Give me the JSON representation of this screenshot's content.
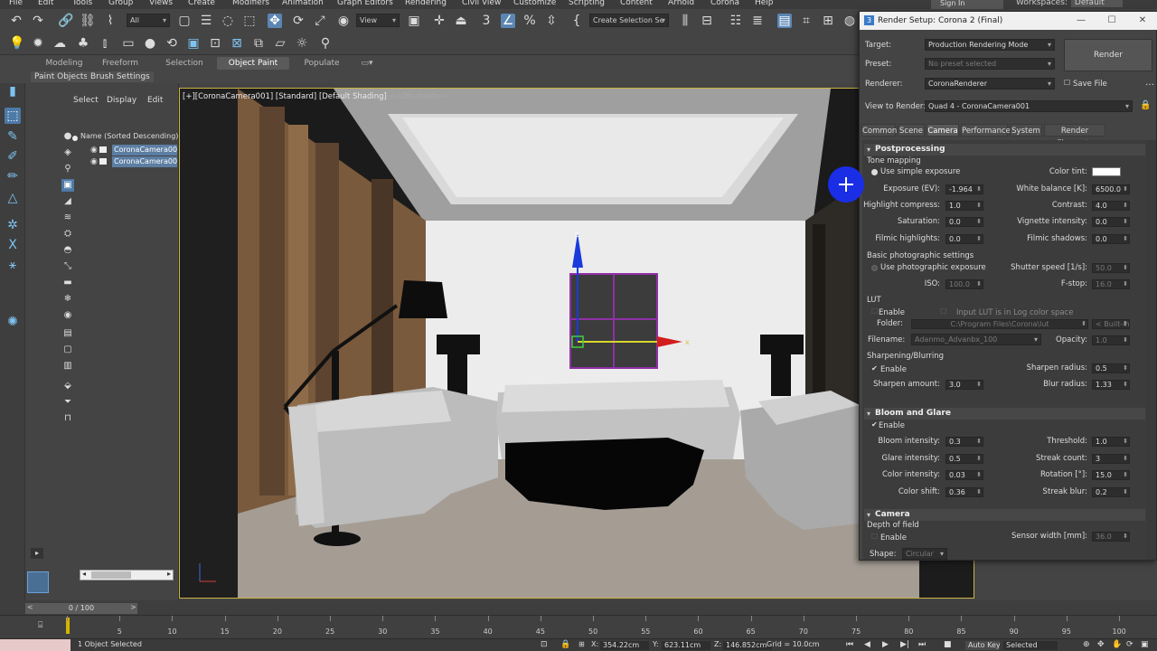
{
  "menubar": {
    "items": [
      "File",
      "Edit",
      "Tools",
      "Group",
      "Views",
      "Create",
      "Modifiers",
      "Animation",
      "Graph Editors",
      "Rendering",
      "Civil View",
      "Customize",
      "Scripting",
      "Content",
      "Arnold",
      "Corona",
      "Help"
    ],
    "sign_in": "Sign In",
    "workspaces_label": "Workspaces:",
    "workspaces_value": "Default"
  },
  "toolbar": {
    "filter": "All",
    "ref_coord": "View",
    "selection_set": "Create Selection Se"
  },
  "ribbon": {
    "tabs": [
      "Modeling",
      "Freeform",
      "Selection",
      "Object Paint",
      "Populate"
    ],
    "active_tab": "Object Paint",
    "subtabs": [
      "Paint Objects",
      "Brush Settings"
    ]
  },
  "explorer": {
    "tabs": [
      "Select",
      "Display",
      "Edit"
    ],
    "column_header": "Name (Sorted Descending)",
    "rows": [
      "CoronaCamera00",
      "CoronaCamera00"
    ]
  },
  "viewport": {
    "label_parts": [
      "[+]",
      "[CoronaCamera001]",
      "[Standard]",
      "[Default Shading]",
      "<<Disabled>>"
    ],
    "axis_labels": [
      "z",
      "x"
    ]
  },
  "render_setup": {
    "title": "Render Setup: Corona 2 (Final)",
    "target_label": "Target:",
    "target_value": "Production Rendering Mode",
    "preset_label": "Preset:",
    "preset_value": "No preset selected",
    "renderer_label": "Renderer:",
    "renderer_value": "CoronaRenderer",
    "save_file": "Save File",
    "view_label": "View to Render:",
    "view_value": "Quad 4 - CoronaCamera001",
    "render_button": "Render",
    "tabs": [
      "Common",
      "Scene",
      "Camera",
      "Performance",
      "System",
      "Render Elements"
    ],
    "active_tab": "Camera",
    "postprocessing": {
      "title": "Postprocessing",
      "tone_mapping": "Tone mapping",
      "use_simple_exposure": "Use simple exposure",
      "exposure_label": "Exposure (EV):",
      "exposure": "-1.964",
      "highlight_label": "Highlight compress:",
      "highlight": "1.0",
      "saturation_label": "Saturation:",
      "saturation": "0.0",
      "filmic_hl_label": "Filmic highlights:",
      "filmic_hl": "0.0",
      "color_tint_label": "Color tint:",
      "color_tint": "#ffffff",
      "wb_label": "White balance [K]:",
      "wb": "6500.0",
      "contrast_label": "Contrast:",
      "contrast": "4.0",
      "vignette_label": "Vignette intensity:",
      "vignette": "0.0",
      "filmic_sh_label": "Filmic shadows:",
      "filmic_sh": "0.0",
      "basic_photo": "Basic photographic settings",
      "use_photo_exposure": "Use photographic exposure",
      "shutter_label": "Shutter speed [1/s]:",
      "shutter": "50.0",
      "iso_label": "ISO:",
      "iso": "100.0",
      "fstop_label": "F-stop:",
      "fstop": "16.0",
      "lut": "LUT",
      "lut_enable": "Enable",
      "lut_log": "Input LUT is in Log color space",
      "folder_label": "Folder:",
      "folder": "C:\\Program Files\\Corona\\lut",
      "builtin": "< Built-in",
      "filename_label": "Filename:",
      "filename": "Adanmo_Advanbx_100",
      "opacity_label": "Opacity:",
      "opacity": "1.0",
      "sharpen_title": "Sharpening/Blurring",
      "sharpen_enable": "Enable",
      "sharpen_amount_label": "Sharpen amount:",
      "sharpen_amount": "3.0",
      "sharpen_radius_label": "Sharpen radius:",
      "sharpen_radius": "0.5",
      "blur_radius_label": "Blur radius:",
      "blur_radius": "1.33"
    },
    "bloom": {
      "title": "Bloom and Glare",
      "enable": "Enable",
      "bloom_int_label": "Bloom intensity:",
      "bloom_int": "0.3",
      "glare_int_label": "Glare intensity:",
      "glare_int": "0.5",
      "color_int_label": "Color intensity:",
      "color_int": "0.03",
      "color_shift_label": "Color shift:",
      "color_shift": "0.36",
      "threshold_label": "Threshold:",
      "threshold": "1.0",
      "streak_count_label": "Streak count:",
      "streak_count": "3",
      "rotation_label": "Rotation [°]:",
      "rotation": "15.0",
      "streak_blur_label": "Streak blur:",
      "streak_blur": "0.2"
    },
    "camera": {
      "title": "Camera",
      "dof": "Depth of field",
      "enable": "Enable",
      "sensor_label": "Sensor width [mm]:",
      "sensor": "36.0",
      "shape_label": "Shape:",
      "shape": "Circular"
    }
  },
  "timeline": {
    "frame_box": "0 / 100",
    "ticks": [
      "0",
      "5",
      "10",
      "15",
      "20",
      "25",
      "30",
      "35",
      "40",
      "45",
      "50",
      "55",
      "60",
      "65",
      "70",
      "75",
      "80",
      "85",
      "90",
      "95",
      "100"
    ]
  },
  "status": {
    "selected": "1 Object Selected",
    "x_label": "X:",
    "x": "354.22cm",
    "y_label": "Y:",
    "y": "623.11cm",
    "z_label": "Z:",
    "z": "146.852cm",
    "grid": "Grid = 10.0cm",
    "auto_key": "Auto Key",
    "key_mode": "Selected"
  },
  "colors": {
    "accent": "#5b86b3",
    "viewport_border": "#c9b540",
    "gizmo_purple": "#8f2fa8"
  }
}
